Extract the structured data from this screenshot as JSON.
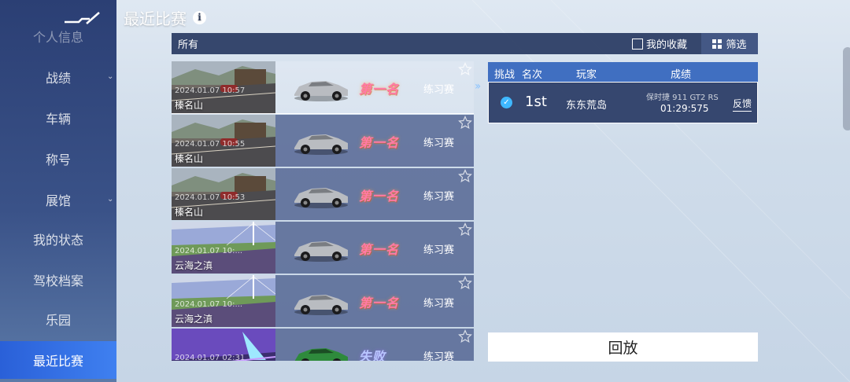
{
  "header": {
    "title": "最近比赛",
    "info_icon": "info-icon"
  },
  "sidebar": {
    "items": [
      {
        "label": "个人信息",
        "has_chevron": false
      },
      {
        "label": "战绩",
        "has_chevron": true
      },
      {
        "label": "车辆",
        "has_chevron": false
      },
      {
        "label": "称号",
        "has_chevron": false
      },
      {
        "label": "展馆",
        "has_chevron": true
      },
      {
        "label": "我的状态",
        "has_chevron": false
      },
      {
        "label": "驾校档案",
        "has_chevron": false
      },
      {
        "label": "乐园",
        "has_chevron": false
      },
      {
        "label": "最近比赛",
        "has_chevron": false,
        "active": true
      }
    ]
  },
  "filter_bar": {
    "all_label": "所有",
    "favorites_label": "我的收藏",
    "filter_label": "筛选"
  },
  "races": [
    {
      "datetime": "2024.01.07 10:57",
      "track": "榛名山",
      "result": "第一名",
      "mode": "练习赛",
      "scene": "mountain",
      "car": "silver",
      "selected": true
    },
    {
      "datetime": "2024.01.07 10:55",
      "track": "榛名山",
      "result": "第一名",
      "mode": "练习赛",
      "scene": "mountain",
      "car": "silver"
    },
    {
      "datetime": "2024.01.07 10:53",
      "track": "榛名山",
      "result": "第一名",
      "mode": "练习赛",
      "scene": "mountain",
      "car": "silver"
    },
    {
      "datetime": "2024.01.07 10:...",
      "track": "云海之滇",
      "result": "第一名",
      "mode": "练习赛",
      "scene": "bridge",
      "car": "silver"
    },
    {
      "datetime": "2024.01.07 10:...",
      "track": "云海之滇",
      "result": "第一名",
      "mode": "练习赛",
      "scene": "bridge",
      "car": "silver"
    },
    {
      "datetime": "2024.01.07 02:31",
      "track": "",
      "result": "失败",
      "mode": "练习赛",
      "scene": "neon",
      "car": "green",
      "lose": true
    }
  ],
  "results_panel": {
    "headers": {
      "challenge": "挑战",
      "rank": "名次",
      "player": "玩家",
      "score": "成绩"
    },
    "rows": [
      {
        "rank": "1st",
        "player": "东东荒岛",
        "car": "保时捷 911 GT2 RS",
        "time": "01:29:575",
        "feedback": "反馈"
      }
    ],
    "replay_label": "回放"
  },
  "colors": {
    "active_tab": "#3a78e8",
    "result_win": "#ff7aa6",
    "panel": "#283a62"
  }
}
